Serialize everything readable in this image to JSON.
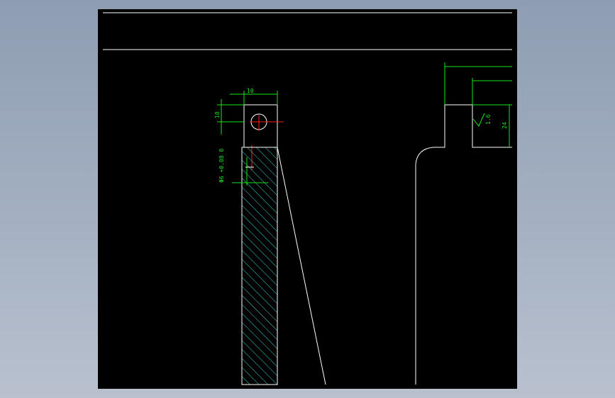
{
  "drawing": {
    "colors": {
      "background": "#000000",
      "geometry": "#ffffff",
      "dimension": "#19e619",
      "hatch": "#35d4d4",
      "centerline": "#ff2020"
    },
    "dimensions": {
      "top_width": "10",
      "left_height": "10",
      "hole_tolerance": "Φ6 +0.08\n     0",
      "surface_roughness": "1.6",
      "right_height": "24"
    }
  }
}
